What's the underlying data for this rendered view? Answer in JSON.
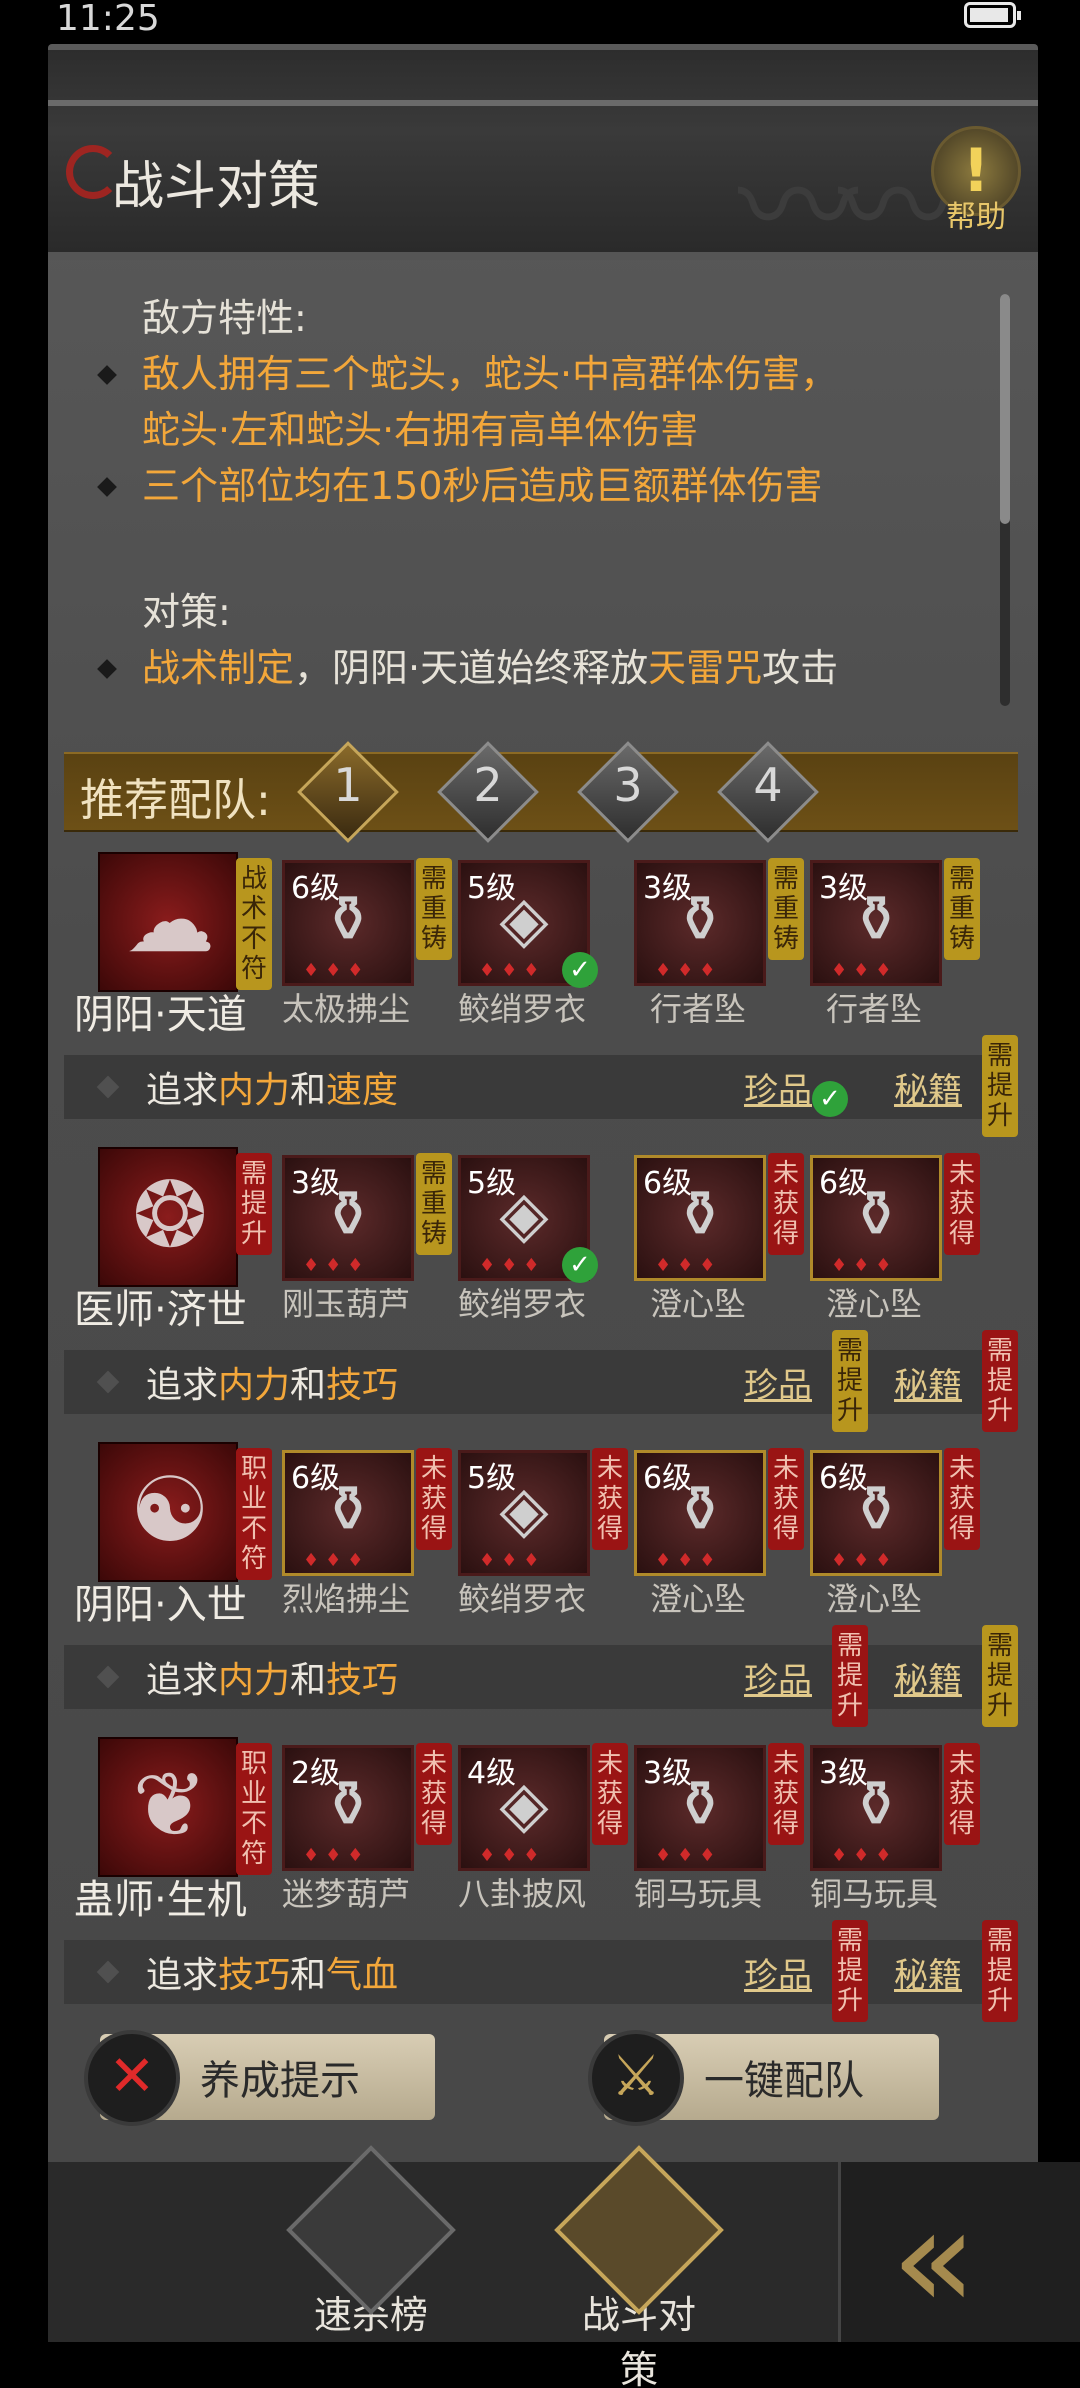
{
  "status": {
    "time": "11:25"
  },
  "header": {
    "title": "战斗对策",
    "help": "帮助"
  },
  "info": {
    "enemy_heading": "敌方特性:",
    "enemy_line1": "敌人拥有三个蛇头，蛇头·中高群体伤害，",
    "enemy_line2": "蛇头·左和蛇头·右拥有高单体伤害",
    "enemy_line3": "三个部位均在150秒后造成巨额群体伤害",
    "counter_heading": "对策:",
    "counter_a": "战术制定",
    "counter_b": "，阴阳·天道始终释放",
    "counter_c": "天雷咒",
    "counter_d": "攻击"
  },
  "recommend": {
    "label": "推荐配队:",
    "tabs": [
      "1",
      "2",
      "3",
      "4"
    ],
    "active": "1"
  },
  "teams": [
    {
      "name": "阴阳·天道",
      "tag": "战术不符",
      "equip": [
        {
          "level": "6级",
          "name": "太极拂尘",
          "tag": "需重铸"
        },
        {
          "level": "5级",
          "name": "鲛绡罗衣"
        },
        {
          "level": "3级",
          "name": "行者坠",
          "tag": "需重铸"
        },
        {
          "level": "3级",
          "name": "行者坠",
          "tag": "需重铸"
        }
      ],
      "pursue": {
        "pre": "追求",
        "a": "内力",
        "mid": "和",
        "b": "速度",
        "rare": "珍品",
        "secret": "秘籍",
        "secret_tag": "需提升"
      }
    },
    {
      "name": "医师·济世",
      "tag": "需提升",
      "equip": [
        {
          "level": "3级",
          "name": "刚玉葫芦",
          "tag": "需重铸"
        },
        {
          "level": "5级",
          "name": "鲛绡罗衣"
        },
        {
          "level": "6级",
          "name": "澄心坠",
          "tag": "未获得"
        },
        {
          "level": "6级",
          "name": "澄心坠",
          "tag": "未获得"
        }
      ],
      "pursue": {
        "pre": "追求",
        "a": "内力",
        "mid": "和",
        "b": "技巧",
        "rare": "珍品",
        "rare_tag": "需提升",
        "secret": "秘籍",
        "secret_tag": "需提升"
      }
    },
    {
      "name": "阴阳·入世",
      "tag": "职业不符",
      "equip": [
        {
          "level": "6级",
          "name": "烈焰拂尘",
          "tag": "未获得"
        },
        {
          "level": "5级",
          "name": "鲛绡罗衣",
          "tag": "未获得"
        },
        {
          "level": "6级",
          "name": "澄心坠",
          "tag": "未获得"
        },
        {
          "level": "6级",
          "name": "澄心坠",
          "tag": "未获得"
        }
      ],
      "pursue": {
        "pre": "追求",
        "a": "内力",
        "mid": "和",
        "b": "技巧",
        "rare": "珍品",
        "rare_tag": "需提升",
        "secret": "秘籍",
        "secret_tag": "需提升"
      }
    },
    {
      "name": "蛊师·生机",
      "tag": "职业不符",
      "equip": [
        {
          "level": "2级",
          "name": "迷梦葫芦",
          "tag": "未获得"
        },
        {
          "level": "4级",
          "name": "八卦披风",
          "tag": "未获得"
        },
        {
          "level": "3级",
          "name": "铜马玩具",
          "tag": "未获得"
        },
        {
          "level": "3级",
          "name": "铜马玩具",
          "tag": "未获得"
        }
      ],
      "pursue": {
        "pre": "追求",
        "a": "技巧",
        "mid": "和",
        "b": "气血",
        "rare": "珍品",
        "rare_tag": "需提升",
        "secret": "秘籍",
        "secret_tag": "需提升"
      }
    }
  ],
  "buttons": {
    "hint": "养成提示",
    "auto": "一键配队"
  },
  "nav": {
    "kill": "速杀榜",
    "battle": "战斗对策"
  },
  "colors": {
    "accent": "#f3a73a",
    "gold_band": "#6d5016",
    "tag_red": "#9a1414",
    "tag_gold": "#b8961e"
  }
}
